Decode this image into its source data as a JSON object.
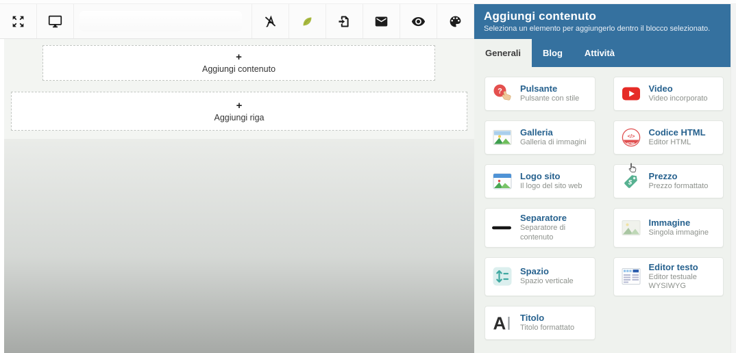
{
  "toolbar": {
    "buttons": [
      {
        "icon": "move-icon"
      },
      {
        "icon": "monitor-icon"
      },
      {
        "icon": "clear-format-icon"
      },
      {
        "icon": "leaf-icon"
      },
      {
        "icon": "import-file-icon"
      },
      {
        "icon": "mail-icon"
      },
      {
        "icon": "eye-icon"
      },
      {
        "icon": "palette-icon"
      }
    ]
  },
  "canvas": {
    "plus_sign": "+",
    "add_content_label": "Aggiungi contenuto",
    "add_row_label": "Aggiungi riga"
  },
  "panel": {
    "title": "Aggiungi contenuto",
    "subtitle": "Seleziona un elemento per aggiungerlo dentro il blocco selezionato.",
    "tabs": [
      {
        "label": "Generali",
        "active": true
      },
      {
        "label": "Blog",
        "active": false
      },
      {
        "label": "Attività",
        "active": false
      }
    ],
    "items": [
      {
        "title": "Pulsante",
        "subtitle": "Pulsante con stile",
        "icon": "button-click-icon"
      },
      {
        "title": "Video",
        "subtitle": "Video incorporato",
        "icon": "video-icon"
      },
      {
        "title": "Galleria",
        "subtitle": "Galleria di immagini",
        "icon": "gallery-icon"
      },
      {
        "title": "Codice HTML",
        "subtitle": "Editor HTML",
        "icon": "html-code-icon"
      },
      {
        "title": "Logo sito",
        "subtitle": "Il logo del sito web",
        "icon": "site-logo-icon"
      },
      {
        "title": "Prezzo",
        "subtitle": "Prezzo formattato",
        "icon": "price-tag-icon"
      },
      {
        "title": "Separatore",
        "subtitle": "Separatore di contenuto",
        "icon": "separator-line-icon"
      },
      {
        "title": "Immagine",
        "subtitle": "Singola immagine",
        "icon": "image-icon"
      },
      {
        "title": "Spazio",
        "subtitle": "Spazio verticale",
        "icon": "vertical-space-icon"
      },
      {
        "title": "Editor testo",
        "subtitle": "Editor testuale WYSIWYG",
        "icon": "text-editor-icon"
      },
      {
        "title": "Titolo",
        "subtitle": "Titolo formattato",
        "icon": "title-letter-icon"
      }
    ]
  },
  "cursor": {
    "icon": "hand-cursor-icon"
  },
  "colors": {
    "panel_blue": "#35719f",
    "tile_title_blue": "#26618e",
    "subtitle_gray": "#8d918c",
    "panel_bg": "#eff2ee",
    "video_red": "#e62b26",
    "button_red": "#e4504e",
    "price_teal": "#57b191",
    "leaf_green": "#a9ba41",
    "gradient_top": "#eaece9",
    "gradient_bottom": "#a6a9a6"
  }
}
